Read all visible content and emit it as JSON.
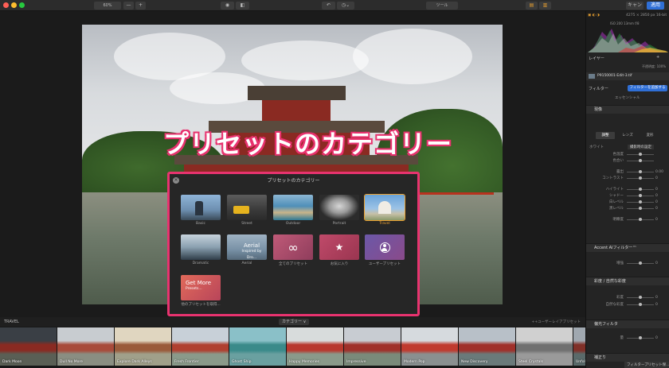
{
  "toolbar": {
    "zoom_value": "60%",
    "zoom_out": "—",
    "zoom_in": "+",
    "tool_label": "ツール",
    "cancel_label": "キャン",
    "apply_label": "適用"
  },
  "overlay_title": "プリセットのカテゴリー",
  "dialog": {
    "title": "プリセットのカテゴリー",
    "close": "×",
    "categories": [
      {
        "label": "Basic"
      },
      {
        "label": "Street"
      },
      {
        "label": "Outdoor"
      },
      {
        "label": "Portrait"
      },
      {
        "label": "Travel",
        "selected": true
      },
      {
        "label": "Dramatic"
      },
      {
        "label": "Aerial",
        "thumb_text": "Aerial",
        "thumb_sub": "Inspired by Dro..."
      },
      {
        "label": "全てのプリセット",
        "icon": "infinity-icon",
        "glyph": "∞"
      },
      {
        "label": "お気に入り",
        "icon": "star-icon",
        "glyph": "★"
      },
      {
        "label": "ユーザープリセット",
        "icon": "user-icon",
        "glyph": "👤"
      },
      {
        "label": "他のプリセットを取得...",
        "thumb_text": "Get More",
        "thumb_sub": "Presets..."
      }
    ]
  },
  "filmstrip": {
    "category_name": "TRAVEL",
    "category_button": "カテゴリー ∨",
    "right_label": "++ユーザーレイアプリセット",
    "presets": [
      "Dark Moon",
      "Dull No More",
      "Explore Dark Alleys",
      "Fresh Frontier",
      "Ghost Ship",
      "Happy Memories",
      "Impressive",
      "Modern Pop",
      "New Discovery",
      "Steel Crystals",
      "Unfold"
    ]
  },
  "panel": {
    "image_info": "4275 × 2850 px   16-bit",
    "exif": "ISO 200    13mm    f/8",
    "layers_label": "レイヤー",
    "opacity": "不透明度: 100%",
    "file_name": "P9150001-Edit-3.tif",
    "filter_label": "フィルター",
    "add_filter_button": "フィルターを追加する",
    "essentials": "エッセンシャル",
    "sections": {
      "develop": "現像",
      "accent_ai": "Accent AIフィルター™",
      "saturation": "彩度 / 自然な彩度",
      "polarize": "偏光フィルタ",
      "crop": "補正り"
    },
    "tabs": [
      "調整",
      "レンズ",
      "変形"
    ],
    "white_balance": "ホワイト",
    "white_balance_value": "撮影時の設定",
    "sliders_top": [
      {
        "label": "色温度",
        "value": ""
      },
      {
        "label": "色合い",
        "value": ""
      }
    ],
    "sliders_mid": [
      {
        "label": "露出",
        "value": "0.00"
      },
      {
        "label": "コントラスト",
        "value": "0"
      }
    ],
    "sliders_tone": [
      {
        "label": "ハイライト",
        "value": "0"
      },
      {
        "label": "シャドー",
        "value": "0"
      },
      {
        "label": "白レベル",
        "value": "0"
      },
      {
        "label": "黒レベル",
        "value": "0"
      }
    ],
    "slider_dehaze": {
      "label": "明瞭度",
      "value": "0"
    },
    "slider_accent": {
      "label": "増強",
      "value": "0"
    },
    "sliders_sat": [
      {
        "label": "彩度",
        "value": "0"
      },
      {
        "label": "自然な彩度",
        "value": "0"
      }
    ],
    "slider_polar": {
      "label": "量",
      "value": "0"
    },
    "save_filter_button": "フィルタープリセット保..."
  },
  "colors": {
    "accent_pink": "#e8336f",
    "accent_blue": "#2f6fd6",
    "selected_orange": "#e8a030"
  }
}
